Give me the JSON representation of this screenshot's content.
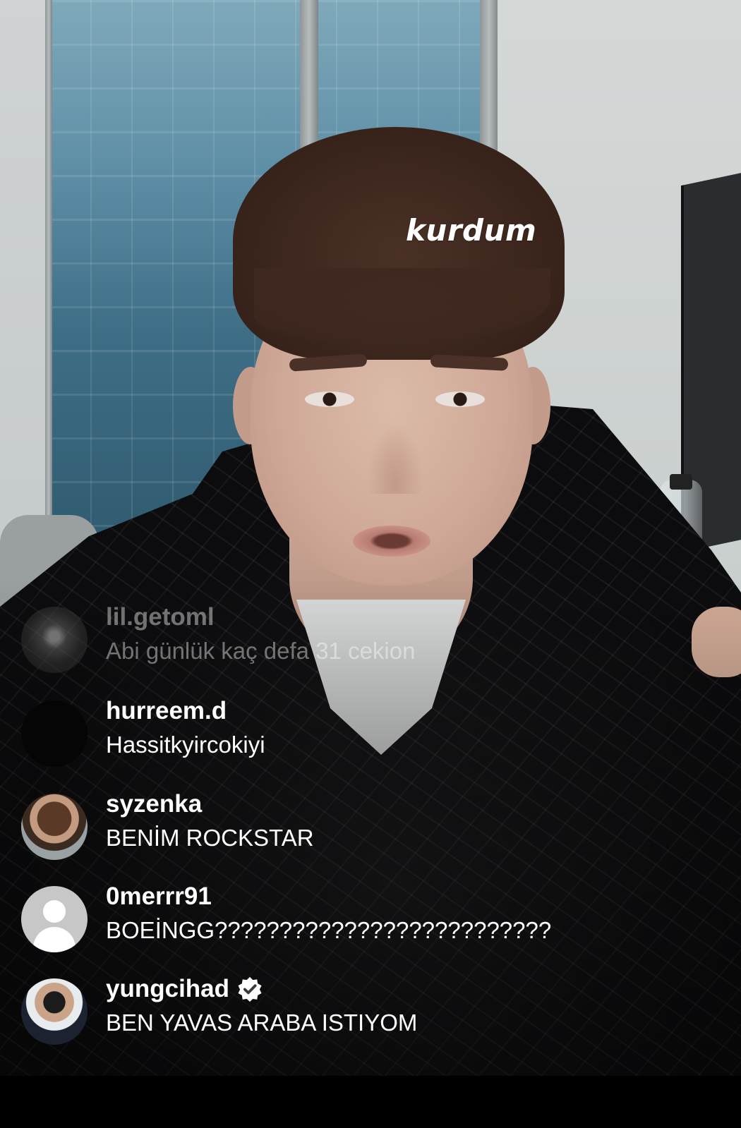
{
  "overlay": {
    "text": "kurdum"
  },
  "comments": [
    {
      "username": "lil.getoml",
      "message": "Abi günlük kaç defa 31  cekion",
      "avatar_icon": "manga-avatar",
      "faded": true,
      "verified": false
    },
    {
      "username": "hurreem.d",
      "message": "Hassitkyircokiyi",
      "avatar_icon": "black-avatar",
      "faded": false,
      "verified": false
    },
    {
      "username": "syzenka",
      "message": "BENİM ROCKSTAR",
      "avatar_icon": "photo-avatar",
      "faded": false,
      "verified": false
    },
    {
      "username": "0merrr91",
      "message": "BOEİNGG??????????????????????????",
      "avatar_icon": "default-user-avatar",
      "faded": false,
      "verified": false
    },
    {
      "username": "yungcihad",
      "message": "BEN YAVAS ARABA ISTIYOM",
      "avatar_icon": "photo-avatar",
      "faded": false,
      "verified": true
    }
  ],
  "colors": {
    "text": "#ffffff",
    "faded_text": "rgba(255,255,255,0.42)",
    "bottom_bar": "#000000"
  }
}
